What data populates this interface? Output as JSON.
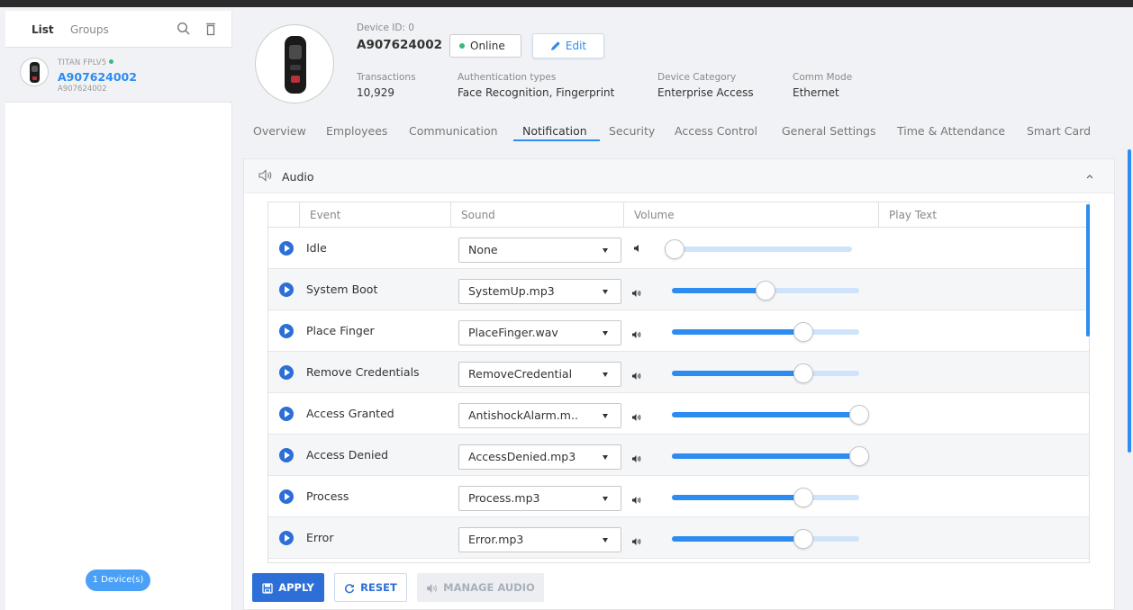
{
  "sidebar": {
    "tab_list": "List",
    "tab_groups": "Groups",
    "device": {
      "model": "TITAN FPLV5",
      "id": "A907624002",
      "serial": "A907624002"
    },
    "device_count": "1 Device(s)"
  },
  "header": {
    "device_id_label": "Device ID: 0",
    "device_id": "A907624002",
    "status": "Online",
    "edit_label": "Edit",
    "fields": [
      {
        "label": "Transactions",
        "value": "10,929"
      },
      {
        "label": "Authentication types",
        "value": "Face Recognition, Fingerprint"
      },
      {
        "label": "Device Category",
        "value": "Enterprise Access"
      },
      {
        "label": "Comm Mode",
        "value": "Ethernet"
      }
    ]
  },
  "tabs": [
    {
      "label": "Overview"
    },
    {
      "label": "Employees"
    },
    {
      "label": "Communication"
    },
    {
      "label": "Notification",
      "active": true
    },
    {
      "label": "Security"
    },
    {
      "label": "Access Control"
    },
    {
      "label": "General Settings"
    },
    {
      "label": "Time & Attendance"
    },
    {
      "label": "Smart Card"
    }
  ],
  "audio": {
    "title": "Audio",
    "columns": [
      "Event",
      "Sound",
      "Volume",
      "Play Text"
    ],
    "rows": [
      {
        "event": "Idle",
        "sound": "None",
        "volume": 0.02,
        "muted": true
      },
      {
        "event": "System Boot",
        "sound": "SystemUp.mp3",
        "volume": 0.5
      },
      {
        "event": "Place Finger",
        "sound": "PlaceFinger.wav",
        "volume": 0.7
      },
      {
        "event": "Remove Credentials",
        "sound": "RemoveCredential",
        "volume": 0.7
      },
      {
        "event": "Access Granted",
        "sound": "AntishockAlarm.m..",
        "volume": 1.0
      },
      {
        "event": "Access Denied",
        "sound": "AccessDenied.mp3",
        "volume": 1.0
      },
      {
        "event": "Process",
        "sound": "Process.mp3",
        "volume": 0.7
      },
      {
        "event": "Error",
        "sound": "Error.mp3",
        "volume": 0.7
      }
    ]
  },
  "footer": {
    "apply": "APPLY",
    "reset": "RESET",
    "manage_audio": "MANAGE AUDIO"
  },
  "colors": {
    "accent": "#2d8cf0",
    "primary_button": "#2d6fd6",
    "online": "#3cb878"
  }
}
